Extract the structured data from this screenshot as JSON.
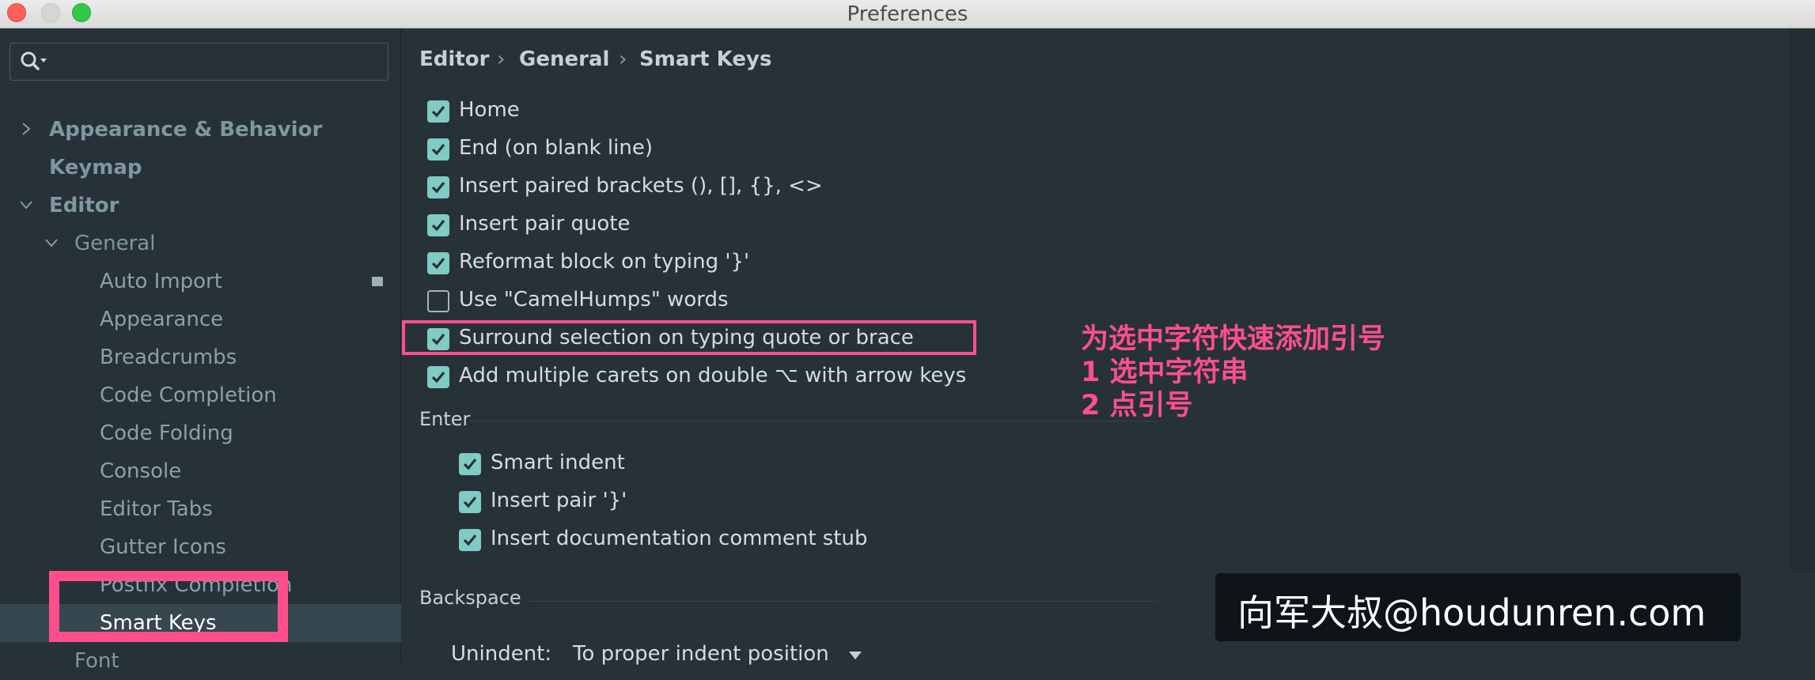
{
  "window": {
    "title": "Preferences"
  },
  "sidebar": {
    "search": {
      "placeholder": ""
    },
    "items": [
      {
        "label": "Appearance & Behavior",
        "level": 0,
        "expanded": false
      },
      {
        "label": "Keymap",
        "level": 0
      },
      {
        "label": "Editor",
        "level": 0,
        "expanded": true
      },
      {
        "label": "General",
        "level": 1,
        "expanded": true
      },
      {
        "label": "Auto Import",
        "level": 2
      },
      {
        "label": "Appearance",
        "level": 2
      },
      {
        "label": "Breadcrumbs",
        "level": 2
      },
      {
        "label": "Code Completion",
        "level": 2
      },
      {
        "label": "Code Folding",
        "level": 2
      },
      {
        "label": "Console",
        "level": 2
      },
      {
        "label": "Editor Tabs",
        "level": 2
      },
      {
        "label": "Gutter Icons",
        "level": 2
      },
      {
        "label": "Postfix Completion",
        "level": 2
      },
      {
        "label": "Smart Keys",
        "level": 2,
        "selected": true
      },
      {
        "label": "Font",
        "level": 1
      }
    ]
  },
  "breadcrumb": {
    "items": [
      "Editor",
      "General",
      "Smart Keys"
    ],
    "separator": "›"
  },
  "options": [
    {
      "label": "Home",
      "checked": true
    },
    {
      "label": "End (on blank line)",
      "checked": true
    },
    {
      "label": "Insert paired brackets (), [], {}, <>",
      "checked": true
    },
    {
      "label": "Insert pair quote",
      "checked": true
    },
    {
      "label": "Reformat block on typing '}'",
      "checked": true
    },
    {
      "label": "Use \"CamelHumps\" words",
      "checked": false
    },
    {
      "label": "Surround selection on typing quote or brace",
      "checked": true
    },
    {
      "label": "Add multiple carets on double ⌥ with arrow keys",
      "checked": true
    }
  ],
  "enter": {
    "title": "Enter",
    "options": [
      {
        "label": "Smart indent",
        "checked": true
      },
      {
        "label": "Insert pair '}'",
        "checked": true
      },
      {
        "label": "Insert documentation comment stub",
        "checked": true
      }
    ]
  },
  "backspace": {
    "title": "Backspace",
    "unindent_label": "Unindent:",
    "unindent_value": "To proper indent position"
  },
  "annotation": {
    "lines": [
      "为选中字符快速添加引号",
      "1 选中字符串",
      "2 点引号"
    ],
    "color": "#ff4f8b"
  },
  "watermark": {
    "text": "向军大叔@houdunren.com"
  },
  "colors": {
    "accent": "#80cbc4",
    "highlight": "#ff4f8b",
    "background": "#263238",
    "selected_row": "#37474f"
  }
}
